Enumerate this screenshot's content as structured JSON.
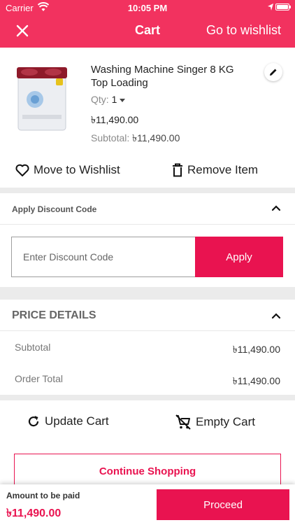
{
  "status_bar": {
    "carrier": "Carrier",
    "time": "10:05 PM"
  },
  "header": {
    "title": "Cart",
    "wishlist_link": "Go to wishlist",
    "bg_color": "#f2325f"
  },
  "cart_item": {
    "name": "Washing Machine Singer 8 KG Top Loading",
    "qty_label": "Qty:",
    "qty_value": "1",
    "price": "৳11,490.00",
    "subtotal_label": "Subtotal:",
    "subtotal_value": "৳11,490.00",
    "move_to_wishlist": "Move to Wishlist",
    "remove_item": "Remove Item"
  },
  "discount": {
    "title": "Apply Discount Code",
    "placeholder": "Enter Discount Code",
    "apply_label": "Apply"
  },
  "price_details": {
    "title": "PRICE DETAILS",
    "rows": [
      {
        "label": "Subtotal",
        "value": "৳11,490.00"
      },
      {
        "label": "Order Total",
        "value": "৳11,490.00"
      }
    ]
  },
  "actions": {
    "update_cart": "Update Cart",
    "empty_cart": "Empty Cart",
    "continue_shopping": "Continue Shopping"
  },
  "footer": {
    "amount_label": "Amount to be paid",
    "amount_value": "৳11,490.00",
    "proceed_label": "Proceed"
  },
  "colors": {
    "accent": "#e91350",
    "header": "#f2325f"
  }
}
